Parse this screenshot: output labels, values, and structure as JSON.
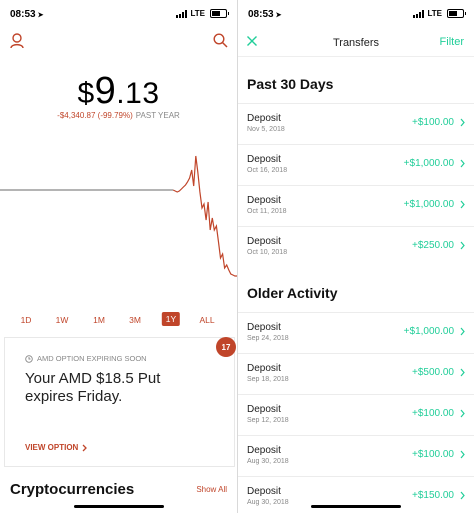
{
  "status_bar": {
    "time": "08:53",
    "network": "LTE"
  },
  "portfolio": {
    "currency": "$",
    "value_int": "9",
    "value_dec": ".13",
    "change": "-$4,340.87 (-99.79%)",
    "change_label": "PAST YEAR",
    "ranges": [
      "1D",
      "1W",
      "1M",
      "3M",
      "1Y",
      "ALL"
    ],
    "selected_range": "1Y"
  },
  "chart_data": {
    "type": "line",
    "title": "",
    "xlabel": "",
    "ylabel": "",
    "description_values": [
      100,
      100,
      100,
      100,
      100,
      100,
      100,
      100,
      100,
      100,
      100,
      100,
      100,
      100,
      100,
      100,
      100,
      100,
      100,
      100,
      100,
      100,
      100,
      100,
      100,
      100,
      100,
      100,
      100,
      100,
      100,
      100,
      100,
      100,
      100,
      100,
      100,
      100,
      100,
      100,
      100,
      100,
      100,
      100,
      100,
      100,
      100,
      100,
      100,
      100,
      100,
      100,
      100,
      100,
      100,
      100,
      100,
      100,
      100,
      100,
      100,
      100,
      100,
      100,
      100,
      100,
      100,
      100,
      100,
      100,
      100,
      100,
      100,
      100,
      100,
      100,
      100,
      100,
      100,
      100,
      100,
      100,
      100,
      100,
      100,
      99,
      98,
      99,
      101,
      103,
      105,
      108,
      112,
      120,
      104,
      134,
      118,
      98,
      82,
      86,
      70,
      88,
      60,
      72,
      60,
      64,
      48,
      32,
      36,
      22,
      25,
      20,
      16,
      15,
      14,
      14
    ],
    "colors": {
      "flat": "#888888",
      "line": "#c0452a"
    }
  },
  "card": {
    "header": "AMD OPTION EXPIRING SOON",
    "title": "Your AMD $18.5 Put expires Friday.",
    "link": "VIEW OPTION",
    "badge": "17"
  },
  "crypto": {
    "title": "Cryptocurrencies",
    "show_all": "Show All"
  },
  "transfers": {
    "title": "Transfers",
    "filter": "Filter",
    "sections": [
      {
        "title": "Past 30 Days",
        "items": [
          {
            "type": "Deposit",
            "date": "Nov 5, 2018",
            "amount": "+$100.00"
          },
          {
            "type": "Deposit",
            "date": "Oct 16, 2018",
            "amount": "+$1,000.00"
          },
          {
            "type": "Deposit",
            "date": "Oct 11, 2018",
            "amount": "+$1,000.00"
          },
          {
            "type": "Deposit",
            "date": "Oct 10, 2018",
            "amount": "+$250.00"
          }
        ]
      },
      {
        "title": "Older Activity",
        "items": [
          {
            "type": "Deposit",
            "date": "Sep 24, 2018",
            "amount": "+$1,000.00"
          },
          {
            "type": "Deposit",
            "date": "Sep 18, 2018",
            "amount": "+$500.00"
          },
          {
            "type": "Deposit",
            "date": "Sep 12, 2018",
            "amount": "+$100.00"
          },
          {
            "type": "Deposit",
            "date": "Aug 30, 2018",
            "amount": "+$100.00"
          },
          {
            "type": "Deposit",
            "date": "Aug 30, 2018",
            "amount": "+$150.00"
          }
        ]
      }
    ]
  },
  "colors": {
    "accent_red": "#c0452a",
    "accent_green": "#21ce99"
  },
  "icons": {
    "profile": "person-icon",
    "search": "search-icon",
    "close": "close-icon",
    "chevron": "chevron-right-icon",
    "clock": "clock-icon",
    "location": "location-arrow-icon"
  }
}
